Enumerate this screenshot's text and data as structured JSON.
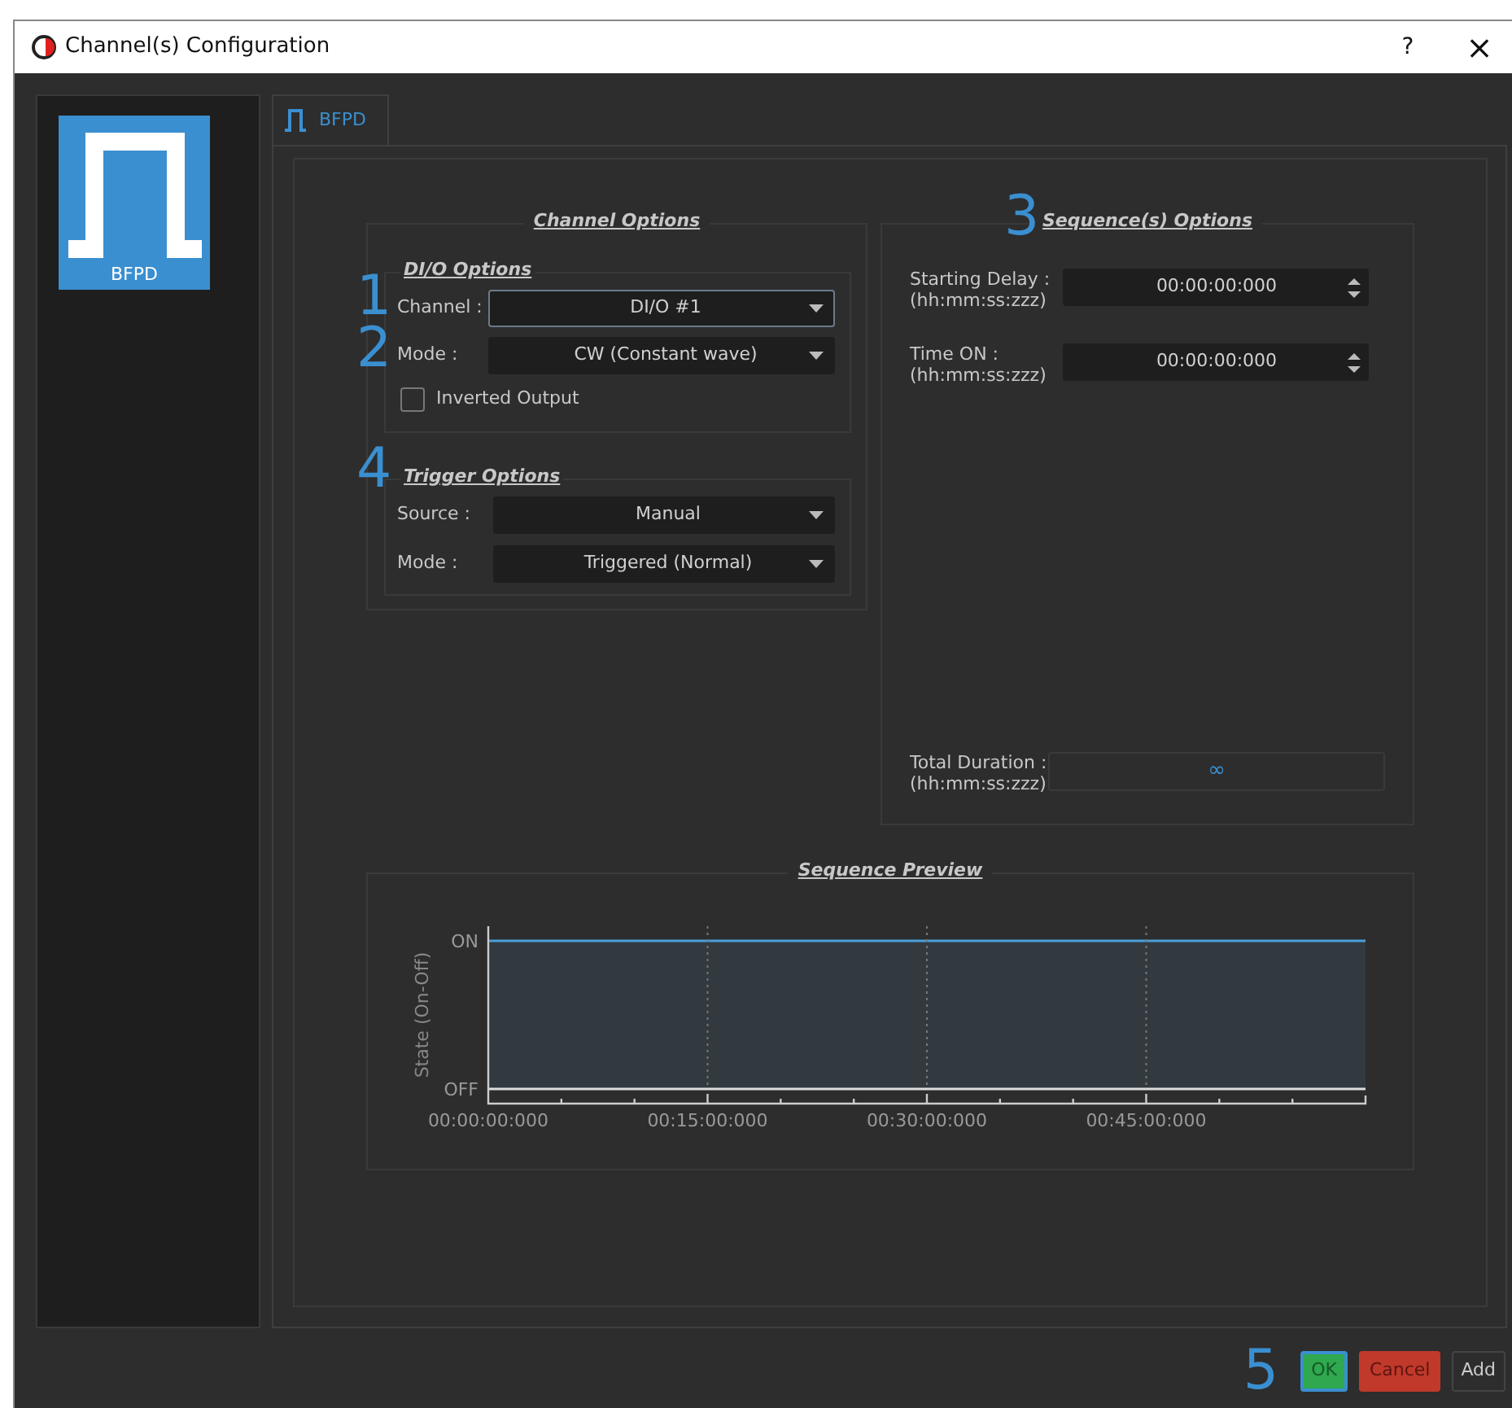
{
  "window": {
    "title": "Channel(s) Configuration",
    "help": "?",
    "close": "×"
  },
  "channels": [
    {
      "label": "BFPD",
      "selected": true
    }
  ],
  "tabs": [
    {
      "label": "BFPD",
      "selected": true
    }
  ],
  "channel_options": {
    "title": "Channel Options",
    "dio_options": {
      "title": "DI/O Options",
      "fields": [
        {
          "label": "Channel :",
          "value": "DI/O #1",
          "callout": "1",
          "focused": true
        },
        {
          "label": "Mode :",
          "value": "CW (Constant wave)",
          "callout": "2",
          "focused": false
        }
      ],
      "inverted_output": {
        "label": "Inverted Output",
        "checked": false
      }
    },
    "trigger_options": {
      "title": "Trigger Options",
      "callout": "4",
      "fields": [
        {
          "label": "Source :",
          "value": "Manual"
        },
        {
          "label": "Mode :",
          "value": "Triggered (Normal)"
        }
      ]
    }
  },
  "sequence_options": {
    "title": "Sequence(s) Options",
    "callout": "3",
    "fields": [
      {
        "label": "Starting Delay :",
        "format": "(hh:mm:ss:zzz)",
        "value": "00:00:00:000"
      },
      {
        "label": "Time ON :",
        "format": "(hh:mm:ss:zzz)",
        "value": "00:00:00:000"
      }
    ],
    "total_duration": {
      "label": "Total Duration :",
      "format": "(hh:mm:ss:zzz)",
      "value": "∞"
    }
  },
  "sequence_preview": {
    "title": "Sequence Preview",
    "y_axis_title": "State (On-Off)",
    "y_tick_labels": [
      "ON",
      "OFF"
    ],
    "x_tick_labels": [
      "00:00:00:000",
      "00:15:00:000",
      "00:30:00:000",
      "00:45:00:000"
    ]
  },
  "footer": {
    "callout": "5",
    "buttons": [
      {
        "label": "OK",
        "kind": "ok"
      },
      {
        "label": "Cancel",
        "kind": "cancel"
      },
      {
        "label": "Add",
        "kind": "add"
      }
    ]
  }
}
